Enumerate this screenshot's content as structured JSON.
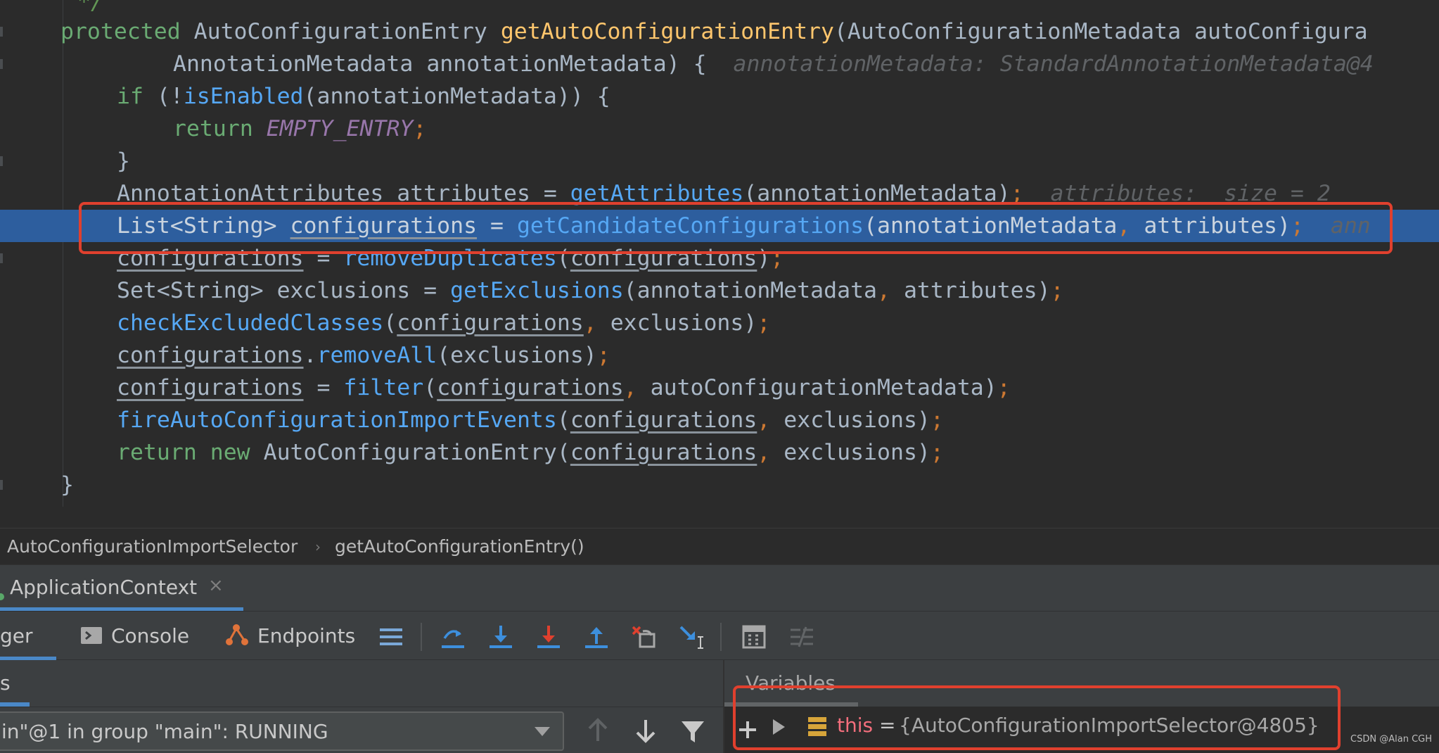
{
  "editor": {
    "lines": [
      {
        "id": "comment-end",
        "parts": [
          {
            "c": "cm",
            "t": "*/"
          }
        ]
      },
      {
        "id": "signature",
        "parts": [
          {
            "c": "kw2",
            "t": "protected "
          },
          {
            "c": "",
            "t": "AutoConfigurationEntry "
          },
          {
            "c": "fn",
            "t": "getAutoConfigurationEntry"
          },
          {
            "c": "",
            "t": "(AutoConfigurationMetadata autoConfigura"
          }
        ]
      },
      {
        "id": "signature-cont",
        "parts": [
          {
            "c": "",
            "t": "AnnotationMetadata annotationMetadata) {  "
          },
          {
            "c": "hint",
            "t": "annotationMetadata: StandardAnnotationMetadata@4"
          }
        ]
      },
      {
        "id": "if-enabled",
        "parts": [
          {
            "c": "kw2",
            "t": "if "
          },
          {
            "c": "",
            "t": "(!"
          },
          {
            "c": "mc",
            "t": "isEnabled"
          },
          {
            "c": "",
            "t": "(annotationMetadata)) {"
          }
        ]
      },
      {
        "id": "return-empty",
        "parts": [
          {
            "c": "kw2",
            "t": "return "
          },
          {
            "c": "cst",
            "t": "EMPTY_ENTRY"
          },
          {
            "c": "op",
            "t": ";"
          }
        ]
      },
      {
        "id": "close-if",
        "parts": [
          {
            "c": "",
            "t": "}"
          }
        ]
      },
      {
        "id": "attributes",
        "parts": [
          {
            "c": "",
            "t": "AnnotationAttributes attributes = "
          },
          {
            "c": "mc",
            "t": "getAttributes"
          },
          {
            "c": "",
            "t": "(annotationMetadata)"
          },
          {
            "c": "op",
            "t": ";  "
          },
          {
            "c": "hint",
            "t": "attributes:  size = 2"
          }
        ]
      },
      {
        "id": "candidate-configs",
        "parts": [
          {
            "c": "",
            "t": "List<String> "
          },
          {
            "c": "ul",
            "t": "configurations"
          },
          {
            "c": "",
            "t": " = "
          },
          {
            "c": "mc",
            "t": "getCandidateConfigurations"
          },
          {
            "c": "",
            "t": "(annotationMetadata"
          },
          {
            "c": "op",
            "t": ", "
          },
          {
            "c": "",
            "t": "attributes)"
          },
          {
            "c": "op",
            "t": ";  "
          },
          {
            "c": "hint",
            "t": "ann"
          }
        ]
      },
      {
        "id": "remove-duplicates",
        "parts": [
          {
            "c": "ul",
            "t": "configurations"
          },
          {
            "c": "",
            "t": " = "
          },
          {
            "c": "mc",
            "t": "removeDuplicates"
          },
          {
            "c": "",
            "t": "("
          },
          {
            "c": "ul",
            "t": "configurations"
          },
          {
            "c": "",
            "t": ")"
          },
          {
            "c": "op",
            "t": ";"
          }
        ]
      },
      {
        "id": "exclusions",
        "parts": [
          {
            "c": "",
            "t": "Set<String> exclusions = "
          },
          {
            "c": "mc",
            "t": "getExclusions"
          },
          {
            "c": "",
            "t": "(annotationMetadata"
          },
          {
            "c": "op",
            "t": ", "
          },
          {
            "c": "",
            "t": "attributes)"
          },
          {
            "c": "op",
            "t": ";"
          }
        ]
      },
      {
        "id": "check-excluded",
        "parts": [
          {
            "c": "mc",
            "t": "checkExcludedClasses"
          },
          {
            "c": "",
            "t": "("
          },
          {
            "c": "ul",
            "t": "configurations"
          },
          {
            "c": "op",
            "t": ", "
          },
          {
            "c": "",
            "t": "exclusions)"
          },
          {
            "c": "op",
            "t": ";"
          }
        ]
      },
      {
        "id": "remove-all",
        "parts": [
          {
            "c": "ul",
            "t": "configurations"
          },
          {
            "c": "",
            "t": "."
          },
          {
            "c": "mc",
            "t": "removeAll"
          },
          {
            "c": "",
            "t": "(exclusions)"
          },
          {
            "c": "op",
            "t": ";"
          }
        ]
      },
      {
        "id": "filter",
        "parts": [
          {
            "c": "ul",
            "t": "configurations"
          },
          {
            "c": "",
            "t": " = "
          },
          {
            "c": "mc",
            "t": "filter"
          },
          {
            "c": "",
            "t": "("
          },
          {
            "c": "ul",
            "t": "configurations"
          },
          {
            "c": "op",
            "t": ", "
          },
          {
            "c": "",
            "t": "autoConfigurationMetadata)"
          },
          {
            "c": "op",
            "t": ";"
          }
        ]
      },
      {
        "id": "fire-events",
        "parts": [
          {
            "c": "mc",
            "t": "fireAutoConfigurationImportEvents"
          },
          {
            "c": "",
            "t": "("
          },
          {
            "c": "ul",
            "t": "configurations"
          },
          {
            "c": "op",
            "t": ", "
          },
          {
            "c": "",
            "t": "exclusions)"
          },
          {
            "c": "op",
            "t": ";"
          }
        ]
      },
      {
        "id": "return-entry",
        "parts": [
          {
            "c": "kw2",
            "t": "return new "
          },
          {
            "c": "",
            "t": "AutoConfigurationEntry("
          },
          {
            "c": "ul",
            "t": "configurations"
          },
          {
            "c": "op",
            "t": ", "
          },
          {
            "c": "",
            "t": "exclusions)"
          },
          {
            "c": "op",
            "t": ";"
          }
        ]
      },
      {
        "id": "close-method",
        "parts": [
          {
            "c": "",
            "t": "}"
          }
        ]
      }
    ]
  },
  "breadcrumb": {
    "class_name": "AutoConfigurationImportSelector",
    "separator": "›",
    "method_name": "getAutoConfigurationEntry()"
  },
  "run_tab": {
    "label": "ApplicationContext",
    "close": "×"
  },
  "toolbar": {
    "debugger_label": "ger",
    "console_label": "Console",
    "endpoints_label": "Endpoints",
    "icons": [
      "menu-icon",
      "step-over-icon",
      "step-into-icon",
      "force-step-into-icon",
      "step-out-icon",
      "drop-frame-icon",
      "run-to-cursor-icon",
      "evaluate-icon",
      "trace-icon"
    ]
  },
  "frames": {
    "header_label": "s",
    "thread_value": "in\"@1 in group \"main\": RUNNING"
  },
  "variables": {
    "header_label": "Variables",
    "rows": [
      {
        "name": "this",
        "equals": "=",
        "value": "{AutoConfigurationImportSelector@4805}"
      }
    ]
  },
  "watermark": "CSDN @Alan CGH",
  "colors": {
    "editor_bg": "#2b2b2b",
    "execution_line": "#2d5e9e",
    "highlight_box": "#e0402e",
    "keyword": "#cc7832",
    "method_call": "#56a8f5",
    "method_decl": "#ffc66d",
    "constant": "#9876aa",
    "tab_accent": "#4a88c7"
  }
}
